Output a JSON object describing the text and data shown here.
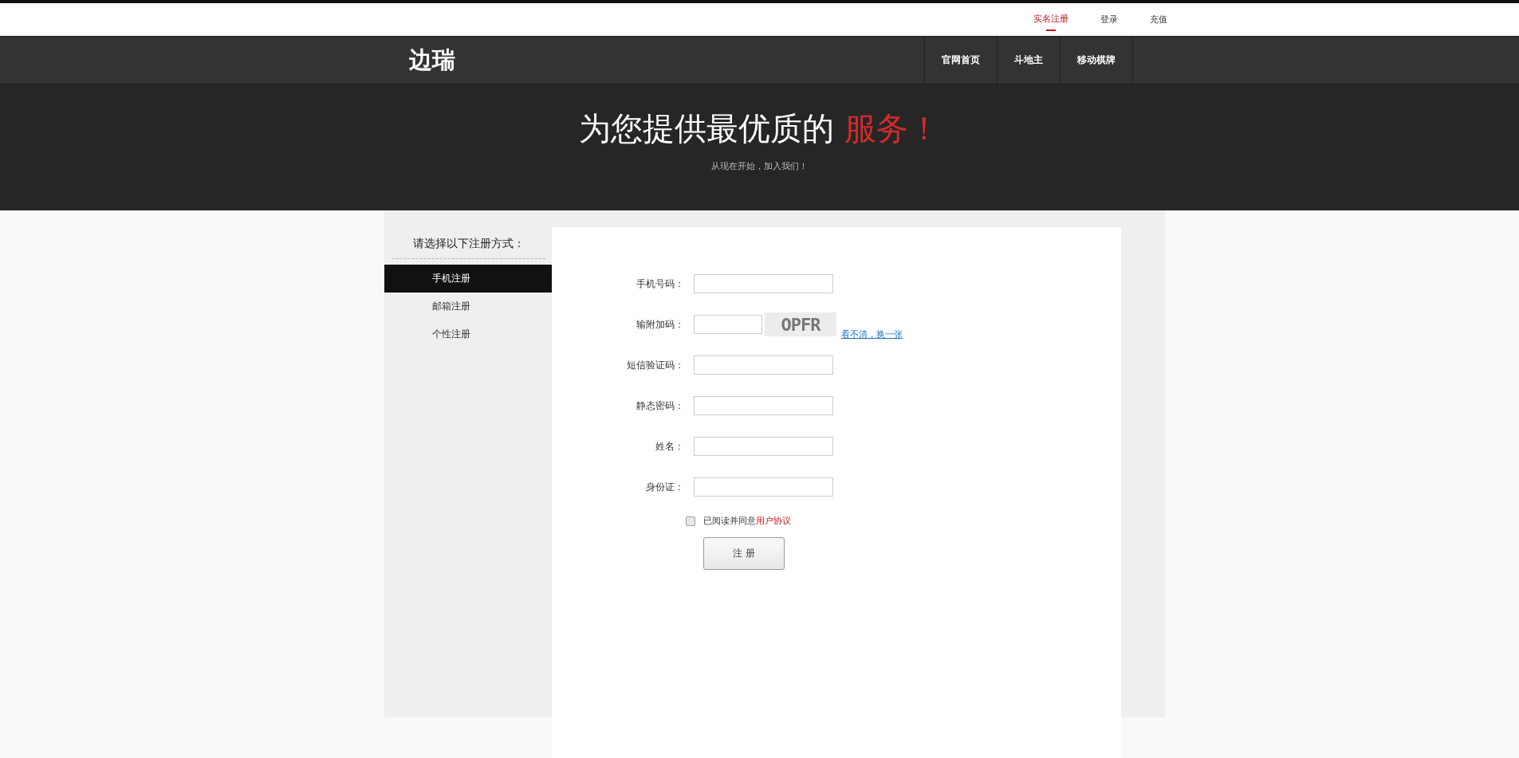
{
  "top_links": [
    {
      "label": "实名注册",
      "selected": true
    },
    {
      "label": "登录",
      "selected": false
    },
    {
      "label": "充值",
      "selected": false
    }
  ],
  "logo": "边瑞",
  "nav": [
    "官网首页",
    "斗地主",
    "移动棋牌"
  ],
  "hero": {
    "title": "为您提供最优质的",
    "highlight": "服务！",
    "subtitle": "从现在开始，加入我们！"
  },
  "sidebar": {
    "heading": "请选择以下注册方式：",
    "items": [
      {
        "label": "手机注册",
        "selected": true
      },
      {
        "label": "邮箱注册",
        "selected": false
      },
      {
        "label": "个性注册",
        "selected": false
      }
    ]
  },
  "form": {
    "fields": [
      {
        "kind": "text",
        "label": "手机号码："
      },
      {
        "kind": "captcha",
        "label": "输附加码：",
        "captcha": "OPFR",
        "refresh_link": "看不清，换一张"
      },
      {
        "kind": "text",
        "label": "短信验证码："
      },
      {
        "kind": "text",
        "label": "静态密码："
      },
      {
        "kind": "text",
        "label": "姓名："
      },
      {
        "kind": "text",
        "label": "身份证："
      }
    ],
    "agree": {
      "checked": false,
      "text": "已阅读并同意",
      "link": "用户协议"
    },
    "submit": "注 册"
  }
}
